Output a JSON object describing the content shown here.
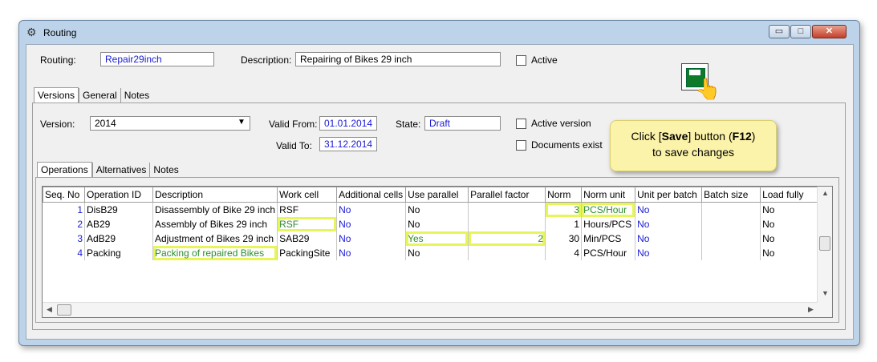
{
  "window": {
    "title": "Routing",
    "controls": {
      "minimize": "▭",
      "maximize": "□",
      "close": "✕"
    }
  },
  "header": {
    "routing_label": "Routing:",
    "routing_value": "Repair29inch",
    "description_label": "Description:",
    "description_value": "Repairing of Bikes 29 inch",
    "active_label": "Active"
  },
  "top_tabs": [
    "Versions",
    "General",
    "Notes"
  ],
  "version": {
    "version_label": "Version:",
    "version_value": "2014",
    "valid_from_label": "Valid From:",
    "valid_from_value": "01.01.2014",
    "valid_to_label": "Valid To:",
    "valid_to_value": "31.12.2014",
    "state_label": "State:",
    "state_value": "Draft",
    "active_version_label": "Active version",
    "documents_exist_label": "Documents exist"
  },
  "inner_tabs": [
    "Operations",
    "Alternatives",
    "Notes"
  ],
  "table": {
    "columns": [
      "Seq. No",
      "Operation ID",
      "Description",
      "Work cell",
      "Additional cells",
      "Use parallel",
      "Parallel factor",
      "Norm",
      "Norm unit",
      "Unit per batch",
      "Batch size",
      "Load fully"
    ],
    "rows": [
      {
        "seq": "1",
        "op": "DisB29",
        "desc": "Disassembly of Bike 29 inch",
        "cell": "RSF",
        "add": "No",
        "par": "No",
        "pf": "",
        "norm": "3",
        "unit": "PCS/Hour",
        "upb": "No",
        "bs": "",
        "lf": "No"
      },
      {
        "seq": "2",
        "op": "AB29",
        "desc": "Assembly of Bikes 29 inch",
        "cell": "RSF",
        "add": "No",
        "par": "No",
        "pf": "",
        "norm": "1",
        "unit": "Hours/PCS",
        "upb": "No",
        "bs": "",
        "lf": "No"
      },
      {
        "seq": "3",
        "op": "AdB29",
        "desc": "Adjustment of Bikes 29 inch",
        "cell": "SAB29",
        "add": "No",
        "par": "Yes",
        "pf": "2",
        "norm": "30",
        "unit": "Min/PCS",
        "upb": "No",
        "bs": "",
        "lf": "No"
      },
      {
        "seq": "4",
        "op": "Packing",
        "desc": "Packing of repaired Bikes",
        "cell": "PackingSite",
        "add": "No",
        "par": "No",
        "pf": "",
        "norm": "4",
        "unit": "PCS/Hour",
        "upb": "No",
        "bs": "",
        "lf": "No"
      }
    ]
  },
  "callout": {
    "pre": "Click [",
    "save": "Save",
    "mid": "] button (",
    "key": "F12",
    "post": ")",
    "line2": "to save changes"
  },
  "icons": {
    "app": "gear-icon",
    "save": "floppy-disk-icon",
    "cursor": "hand-pointer-icon"
  },
  "colors": {
    "value_blue": "#1a1ad6",
    "highlight": "#e8f55a",
    "callout": "#fbf3a9"
  }
}
